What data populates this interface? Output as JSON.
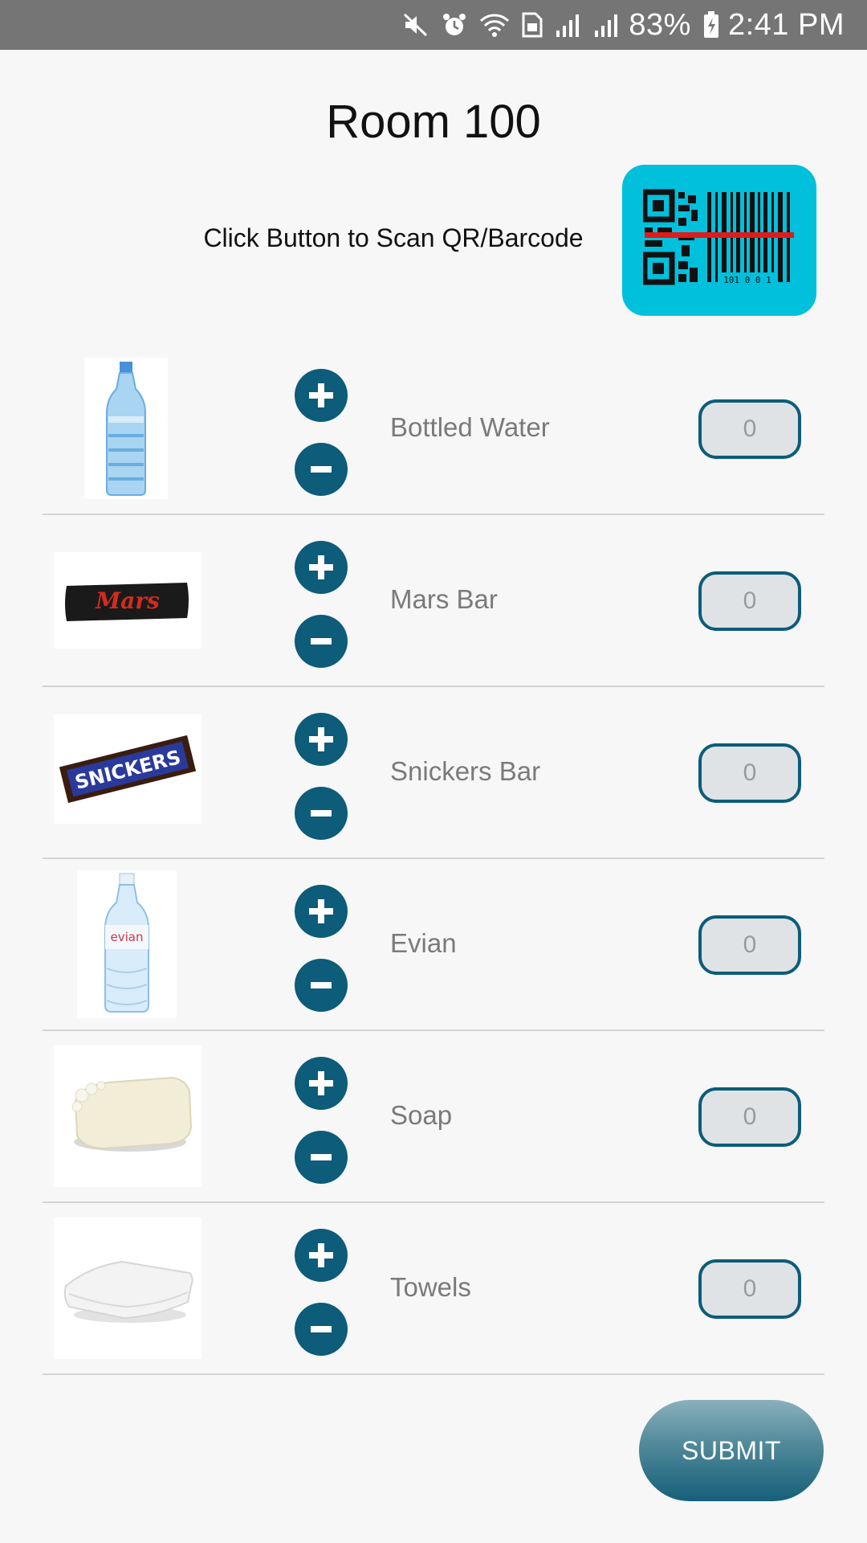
{
  "status_bar": {
    "battery": "83%",
    "time": "2:41 PM",
    "icons": [
      "mute-icon",
      "alarm-icon",
      "wifi-icon",
      "sim-icon",
      "signal-icon",
      "signal-icon",
      "battery-charging-icon"
    ]
  },
  "header": {
    "title": "Room 100"
  },
  "scan": {
    "label": "Click Button to Scan QR/Barcode",
    "button_icon": "qr-barcode-scanner-icon",
    "barcode_text": "101 0 0 1",
    "accent": "#00c0dc"
  },
  "items": [
    {
      "name": "Bottled Water",
      "quantity": "0",
      "image": "bottled-water-image"
    },
    {
      "name": "Mars Bar",
      "quantity": "0",
      "image": "mars-bar-image"
    },
    {
      "name": "Snickers Bar",
      "quantity": "0",
      "image": "snickers-bar-image"
    },
    {
      "name": "Evian",
      "quantity": "0",
      "image": "evian-bottle-image"
    },
    {
      "name": "Soap",
      "quantity": "0",
      "image": "soap-image"
    },
    {
      "name": "Towels",
      "quantity": "0",
      "image": "towels-image"
    }
  ],
  "mars_logo": "Mars",
  "snickers_logo": "SNICKERS",
  "evian_logo": "evian",
  "controls": {
    "plus_icon": "plus-icon",
    "minus_icon": "minus-icon",
    "button_color": "#0c5c7a"
  },
  "footer": {
    "submit_label": "SUBMIT"
  }
}
